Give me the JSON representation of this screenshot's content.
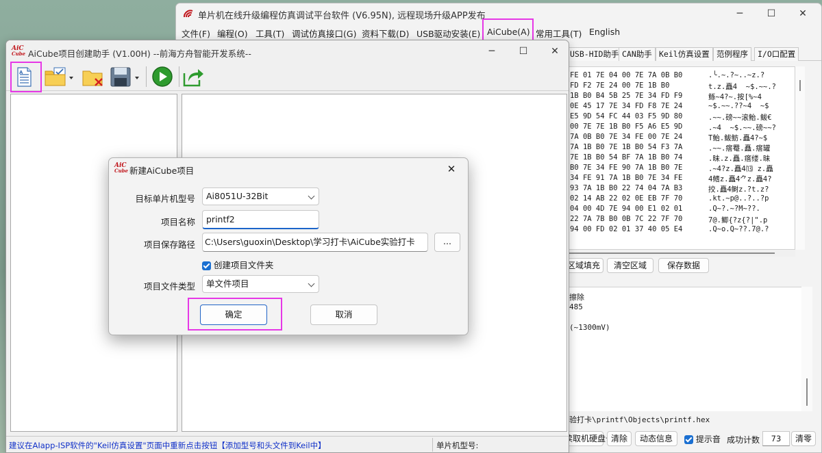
{
  "isp": {
    "title": "单片机在线升级编程仿真调试平台软件 (V6.95N), 远程现场升级APP发布",
    "menu": [
      "文件(F)",
      "编程(O)",
      "工具(T)",
      "调试仿真接口(G)",
      "资料下载(D)",
      "USB驱动安装(E)",
      "AiCube(A)",
      "常用工具(T)",
      "English"
    ],
    "tabs": [
      "USB-HID助手",
      "CAN助手",
      "Keil仿真设置",
      "范例程序",
      "I/O口配置"
    ],
    "hex_rows": [
      "FE 01 7E 04 00 7E 7A 0B B0",
      "FD F2 7E 24 00 7E 1B B0",
      "1B B0 B4 5B 25 7E 34 FD F9",
      "0E 45 17 7E 34 FD F8 7E 24",
      "E5 9D 54 FC 44 03 F5 9D 80",
      "00 7E 7E 1B B0 F5 A6 E5 9D",
      "7A 0B B0 7E 34 FE 00 7E 24",
      "7A 1B B0 7E 1B B0 54 F3 7A",
      "7E 1B B0 54 BF 7A 1B B0 74",
      "B0 7E 34 FE 90 7A 1B B0 7E",
      "34 FE 91 7A 1B B0 7E 34 FE",
      "93 7A 1B B0 22 74 04 7A B3",
      "02 14 AB 22 02 0E EB 7F 70",
      "04 00 4D 7E 94 00 E1 02 01",
      "22 7A 7B B0 0B 7C 22 7F 70",
      "94 00 FD 02 01 37 40 05 E4"
    ],
    "ascii_rows": [
      ".╰.~.?~..~z.?",
      "t.z.矗4  ~$.~~.?",
      "鲧~4?~.按[%~4",
      "~$.~~.??~4  ~$",
      ".~~.磅~~滚鲐.鲅€",
      ".~4  ~$.~~.磅~~?",
      "T鲐.鲅鲂.矗4?~$",
      ".~~.瘩罨.矗.瘩罐",
      ".昧.z.矗.瘩缕.昧",
      ".~4?z.矗4⒀ z.矗",
      "4鳍z.矗4⺈z.矗4?",
      "挍.矗4鲥z.?t.z?",
      ".kt.~p@..?..?p",
      ".Q~?.~?M~??.",
      "7@.鲫{?z{?|\".p",
      ".Q~o.Q~??.7@.?"
    ],
    "buttons_row": [
      "区域填充",
      "清空区域",
      "保存数据"
    ],
    "log_lines": [
      "擦除",
      "485",
      "",
      "",
      "(~1300mV)"
    ],
    "path_text": "验打卡\\printf\\Objects\\printf.hex",
    "bottom": {
      "read_button": "读取机硬盘号",
      "clear_button": "清除",
      "dynamic_button": "动态信息",
      "beep_label": "提示音",
      "success_label": "成功计数",
      "success_count": "73",
      "clear2_button": "清零"
    }
  },
  "aicube": {
    "title": "AiCube项目创建助手 (V1.00H) --前海方舟智能开发系统--",
    "logo_text": "AiC",
    "logo_sub": "Cube",
    "status_message": "建议在AIapp-ISP软件的\"Keil仿真设置\"页面中重新点击按钮【添加型号和头文件到Keil中】",
    "status_mcu_label": "单片机型号:"
  },
  "dialog": {
    "title": "新建AiCube项目",
    "mcu_label": "目标单片机型号",
    "mcu_value": "Ai8051U-32Bit",
    "name_label": "项目名称",
    "name_value": "printf2",
    "path_label": "项目保存路径",
    "path_value": "C:\\Users\\guoxin\\Desktop\\学习打卡\\AiCube实验打卡",
    "browse_label": "...",
    "create_folder_label": "创建项目文件夹",
    "type_label": "项目文件类型",
    "type_value": "单文件项目",
    "ok_label": "确定",
    "cancel_label": "取消"
  },
  "colors": {
    "highlight": "#e637e6",
    "status_text": "#1030c8",
    "accent": "#1f63c6"
  }
}
